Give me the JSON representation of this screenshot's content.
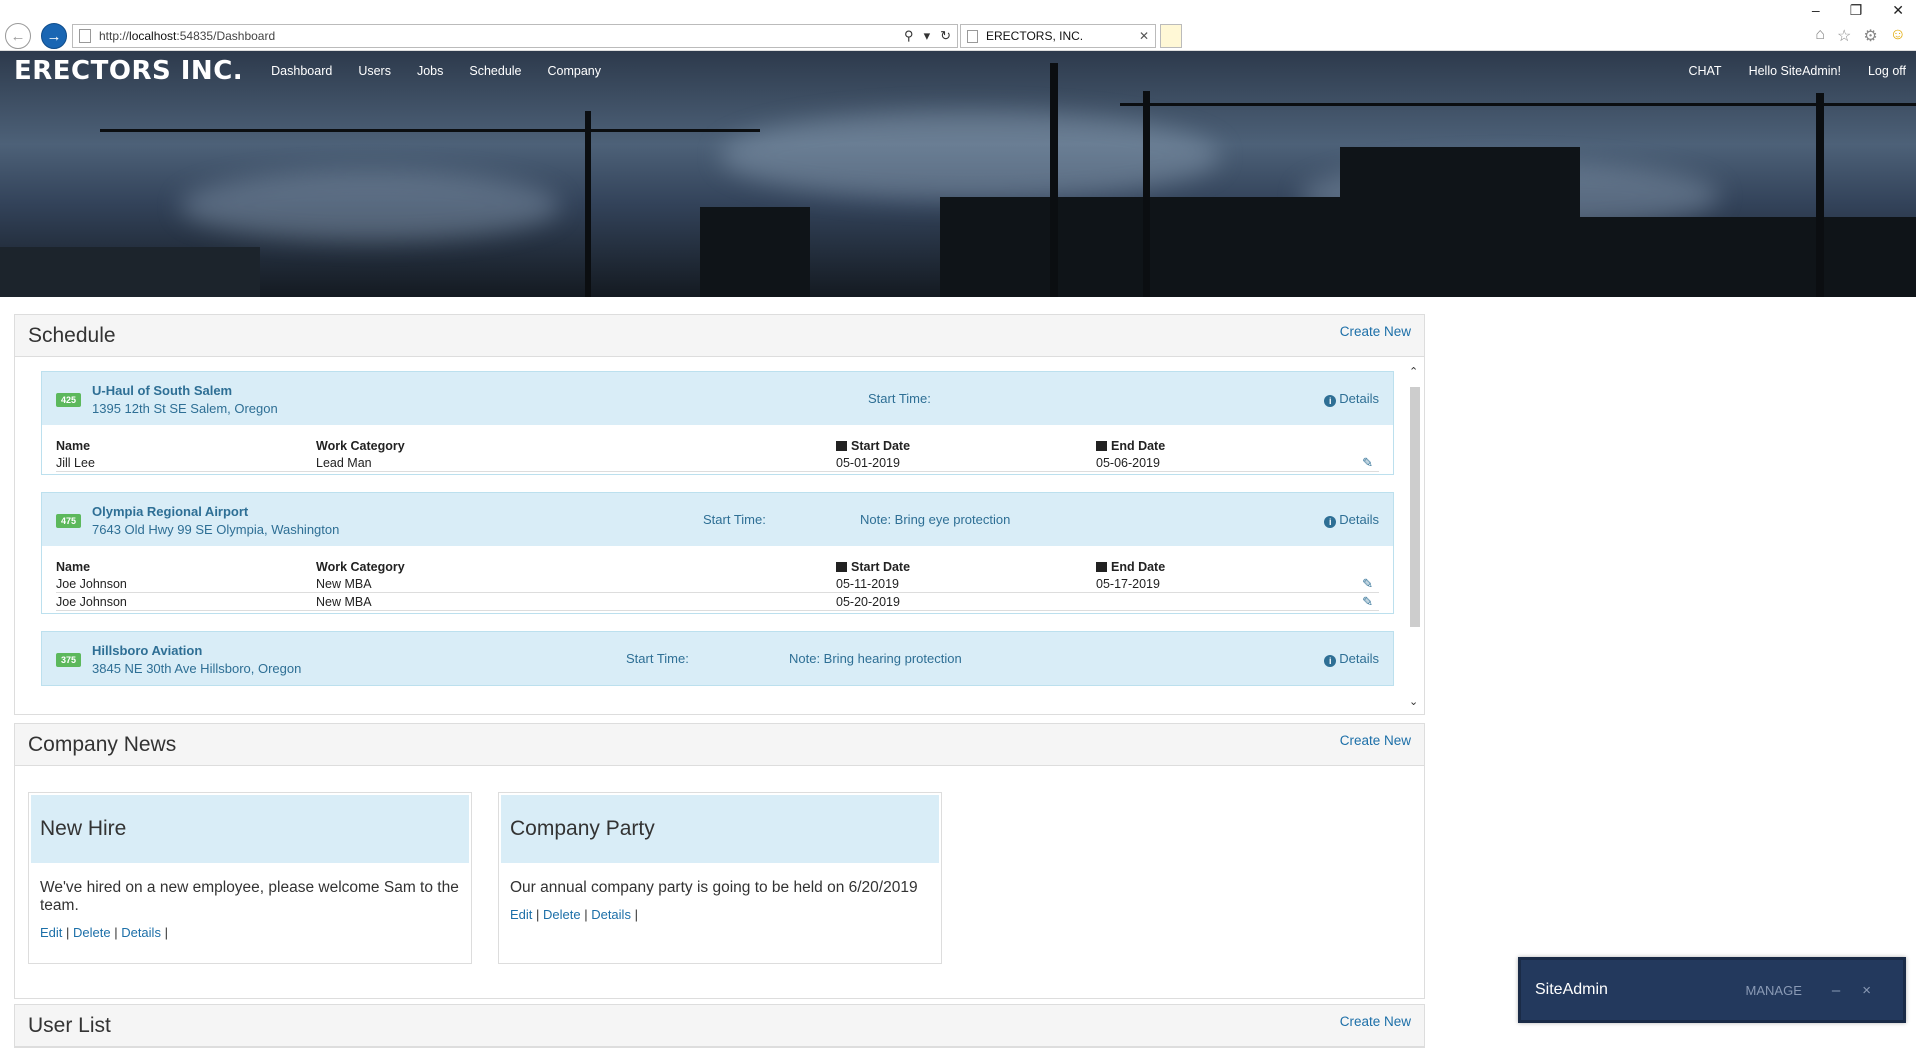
{
  "browser": {
    "url_prefix": "http://",
    "url_host": "localhost",
    "url_rest": ":54835/Dashboard",
    "tab_title": "ERECTORS, INC.",
    "win_min": "–",
    "win_restore": "❐",
    "win_close": "✕"
  },
  "nav": {
    "brand": "ERECTORS INC.",
    "links": [
      "Dashboard",
      "Users",
      "Jobs",
      "Schedule",
      "Company"
    ],
    "chat": "CHAT",
    "hello": "Hello SiteAdmin!",
    "logoff": "Log off"
  },
  "schedule": {
    "title": "Schedule",
    "create_new": "Create New",
    "details_label": "Details",
    "start_time_label": "Start Time:",
    "columns": [
      "Name",
      "Work Category",
      "Start Date",
      "End Date"
    ],
    "jobs": [
      {
        "badge": "425",
        "name": "U-Haul of South Salem",
        "address": "1395 12th St SE Salem, Oregon",
        "note": "",
        "rows": [
          {
            "name": "Jill Lee",
            "category": "Lead Man",
            "start": "05-01-2019",
            "end": "05-06-2019"
          }
        ]
      },
      {
        "badge": "475",
        "name": "Olympia Regional Airport",
        "address": "7643 Old Hwy 99 SE Olympia, Washington",
        "note": "Note: Bring eye protection",
        "rows": [
          {
            "name": "Joe Johnson",
            "category": "New MBA",
            "start": "05-11-2019",
            "end": "05-17-2019"
          },
          {
            "name": "Joe Johnson",
            "category": "New MBA",
            "start": "05-20-2019",
            "end": ""
          }
        ]
      },
      {
        "badge": "375",
        "name": "Hillsboro Aviation",
        "address": "3845 NE 30th Ave Hillsboro, Oregon",
        "note": "Note: Bring hearing protection",
        "rows": []
      }
    ]
  },
  "news": {
    "title": "Company News",
    "create_new": "Create New",
    "cards": [
      {
        "title": "New Hire",
        "text": "We've hired on a new employee, please welcome Sam to the team.",
        "edit": "Edit",
        "delete": "Delete",
        "details": "Details"
      },
      {
        "title": "Company Party",
        "text": "Our annual company party is going to be held on 6/20/2019",
        "edit": "Edit",
        "delete": "Delete",
        "details": "Details"
      }
    ]
  },
  "userlist": {
    "title": "User List",
    "create_new": "Create New"
  },
  "chat_widget": {
    "name": "SiteAdmin",
    "manage": "MANAGE",
    "minimize": "–",
    "close": "×"
  },
  "colors": {
    "accent_link": "#1c6fa8",
    "job_header_bg": "#d9edf7",
    "badge_green": "#5cb85c",
    "chat_bg": "#23395d"
  }
}
